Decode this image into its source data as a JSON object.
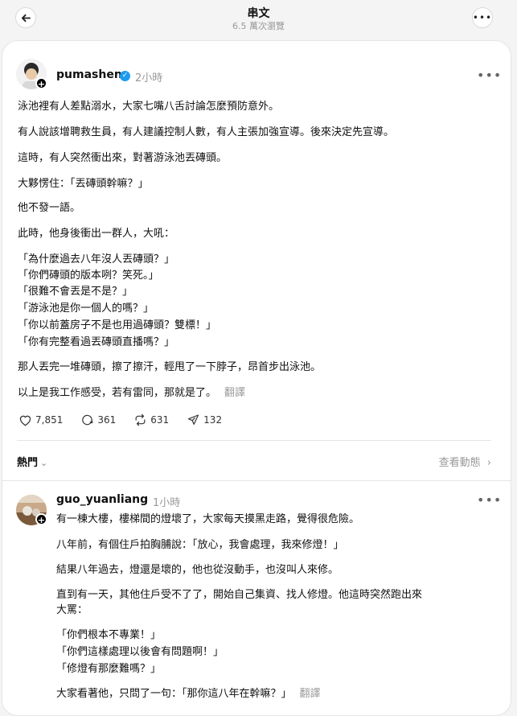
{
  "header": {
    "title": "串文",
    "views": "6.5 萬次瀏覽"
  },
  "post": {
    "username": "pumashen",
    "time": "2小時",
    "paragraphs": [
      "泳池裡有人差點溺水，大家七嘴八舌討論怎麼預防意外。",
      "有人說該增聘救生員，有人建議控制人數，有人主張加強宣導。後來決定先宣導。",
      "這時，有人突然衝出來，對著游泳池丟磚頭。",
      "大夥愣住：「丟磚頭幹嘛？」",
      "他不發一語。",
      "此時，他身後衝出一群人，大吼：",
      "「為什麼過去八年沒人丟磚頭？」",
      "「你們磚頭的版本咧？笑死。」",
      "「很難不會丟是不是？」",
      "「游泳池是你一個人的嗎？」",
      "「你以前蓋房子不是也用過磚頭？雙標！」",
      "「你有完整看過丟磚頭直播嗎？」",
      "那人丟完一堆磚頭，擦了擦汗，輕甩了一下脖子，昂首步出泳池。",
      "以上是我工作感受，若有雷同，那就是了。"
    ],
    "translate": "翻譯",
    "likes": "7,851",
    "comments": "361",
    "reposts": "631",
    "shares": "132"
  },
  "replies_bar": {
    "sort_label": "熱門",
    "activity_label": "查看動態"
  },
  "reply": {
    "username": "guo_yuanliang",
    "time": "1小時",
    "paragraphs": [
      "有一棟大樓，樓梯間的燈壞了，大家每天摸黑走路，覺得很危險。",
      "八年前，有個住戶拍胸脯說：「放心，我會處理，我來修燈！」",
      "結果八年過去，燈還是壞的，他也從沒動手，也沒叫人來修。",
      "直到有一天，其他住戶受不了了，開始自己集資、找人修燈。他這時突然跑出來",
      "大罵：",
      "「你們根本不專業！」",
      "「你們這樣處理以後會有問題啊！」",
      "「修燈有那麼難嗎？」",
      "大家看著他，只問了一句：「那你這八年在幹嘛？」"
    ],
    "translate": "翻譯"
  }
}
